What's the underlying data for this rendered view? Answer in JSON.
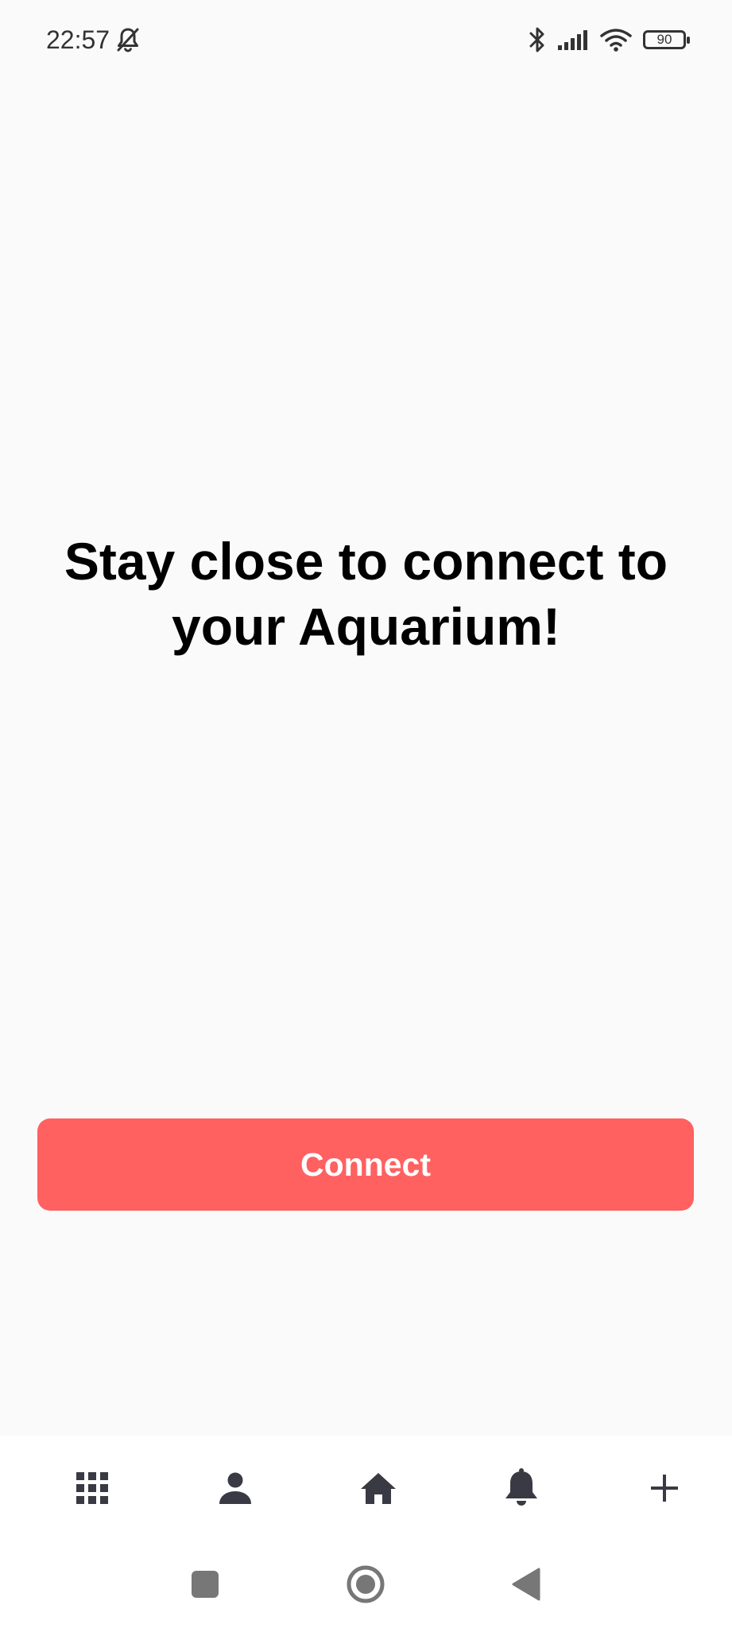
{
  "status_bar": {
    "time": "22:57",
    "battery_level": "90",
    "icons": [
      "bell-off-icon",
      "bluetooth-icon",
      "signal-icon",
      "wifi-icon",
      "battery-icon"
    ]
  },
  "main": {
    "headline": "Stay close to connect to your Aquarium!",
    "connect_label": "Connect"
  },
  "bottom_nav": {
    "items": [
      {
        "icon": "grid-icon"
      },
      {
        "icon": "person-icon"
      },
      {
        "icon": "home-icon"
      },
      {
        "icon": "bell-icon"
      },
      {
        "icon": "plus-icon"
      }
    ]
  },
  "system_nav": {
    "items": [
      "recents-square-icon",
      "home-circle-icon",
      "back-triangle-icon"
    ]
  },
  "colors": {
    "accent": "#ff6161",
    "background": "#fafafa",
    "icon": "#3a3a44"
  }
}
